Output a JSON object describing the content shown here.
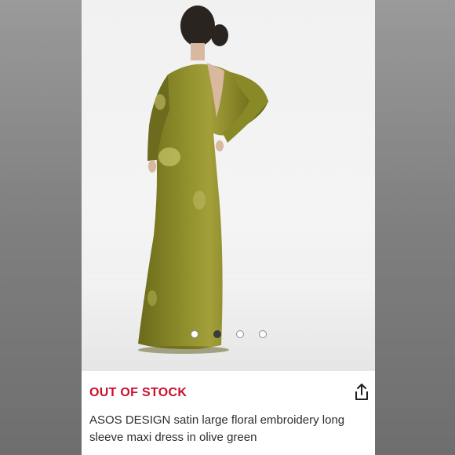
{
  "product": {
    "status": "OUT OF STOCK",
    "title": "ASOS DESIGN satin large floral embroidery long sleeve maxi dress in olive green",
    "image_alt": "Model wearing olive green satin maxi dress, back view"
  },
  "carousel": {
    "total": 4,
    "active": 2
  },
  "icons": {
    "share": "share-icon"
  },
  "colors": {
    "status": "#c8102e",
    "dress": "#7a7a22"
  }
}
